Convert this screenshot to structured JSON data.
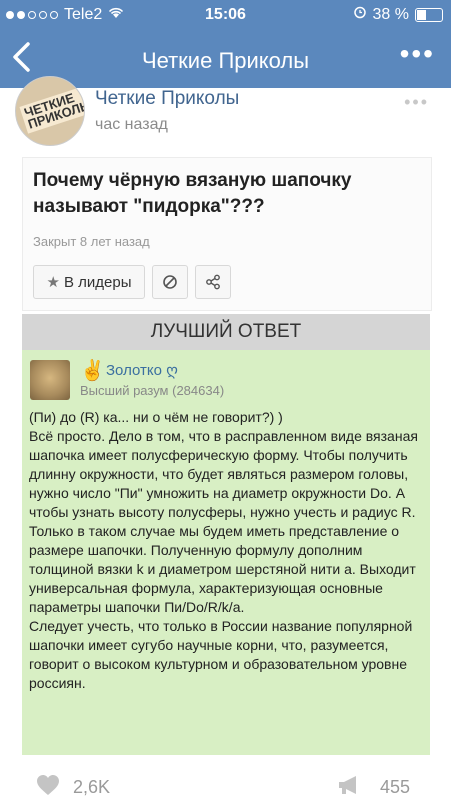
{
  "status_bar": {
    "carrier": "Tele2",
    "time": "15:06",
    "battery": "38 %",
    "battery_level": 0.38
  },
  "nav": {
    "title": "Четкие Приколы",
    "back_icon": "chevron-left-icon",
    "more_icon": "more-dots-icon"
  },
  "post": {
    "author": "Четкие Приколы",
    "time": "час назад",
    "avatar_text": "ЧЕТКИЕ ПРИКОЛЫ"
  },
  "question": {
    "title": "Почему чёрную вязаную шапочку называют \"пидорка\"???",
    "status": "Закрыт 8 лет назад",
    "leaders_button": "В лидеры"
  },
  "best_answer": {
    "header": "ЛУЧШИЙ ОТВЕТ",
    "author": "Золотко ღ",
    "emoji": "✌",
    "rank": "Высший разум (284634)",
    "text": "(Пи) до (R) ка... ни о чём не говорит?) )\nВсё просто. Дело в том, что в расправленном виде вязаная шапочка имеет полусферическую форму. Чтобы получить длинну окружности, что будет являться размером головы, нужно число \"Пи\" умножить на диаметр окружности Do. А чтобы узнать высоту полусферы, нужно учесть и радиус R. Только в таком случае мы будем иметь представление о размере шапочки. Полученную формулу дополним толщиной вязки k и диаметром шерстяной нити a. Выходит универсальная формула, характеризующая основные параметры шапочки Пи/Do/R/k/a.\nСледует учесть, что только в России название популярной шапочки имеет сугубо научные корни, что, разумеется, говорит о высоком культурном и образовательном уровне россиян."
  },
  "footer": {
    "likes": "2,6K",
    "reposts": "455"
  },
  "colors": {
    "header_blue": "#5b88bd",
    "answer_green": "#d8efc4",
    "link_blue": "#41658f"
  }
}
